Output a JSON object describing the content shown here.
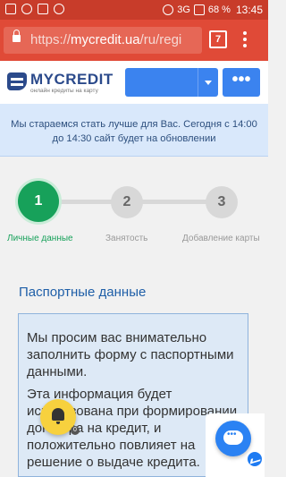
{
  "statusbar": {
    "battery": "68 %",
    "time": "13:45",
    "network": "3G"
  },
  "browser": {
    "url_prefix": "https://",
    "url_host": "mycredit.ua",
    "url_path": "/ru/regi",
    "tab_count": "7"
  },
  "header": {
    "logo_name": "MYCREDIT",
    "logo_tagline": "онлайн кредиты на карту",
    "more_label": "•••"
  },
  "notice": {
    "text": "Мы стараемся стать лучше для Вас. Сегодня с 14:00 до 14:30 сайт будет на обновлении"
  },
  "steps": [
    {
      "number": "1",
      "label": "Личные данные"
    },
    {
      "number": "2",
      "label": "Занятость"
    },
    {
      "number": "3",
      "label": "Добавление карты"
    }
  ],
  "section": {
    "title": "Паспортные данные"
  },
  "info": {
    "p1": "Мы просим вас внимательно заполнить форму с паспортными данными.",
    "p2": "Эта информация будет использована при формировании договора на кредит, и положительно повлияет на решение о выдаче кредита."
  },
  "widgets": {
    "bell_count": "0"
  }
}
